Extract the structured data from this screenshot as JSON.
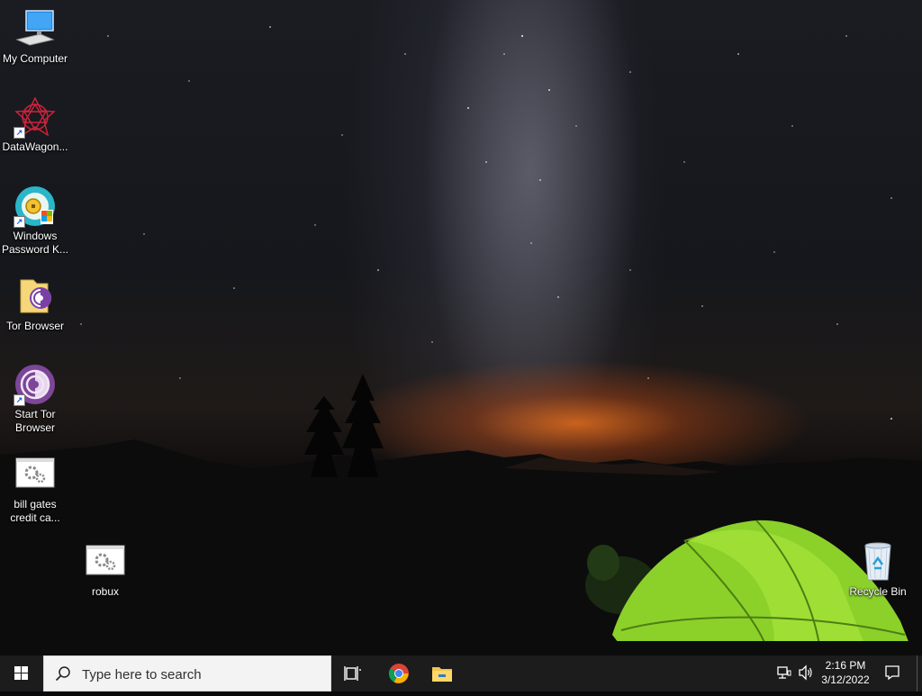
{
  "desktop": {
    "icons": [
      {
        "label": "My Computer",
        "icon": "computer-icon"
      },
      {
        "label": "DataWagon...",
        "icon": "datawagon-icon"
      },
      {
        "label": "Windows Password K...",
        "icon": "password-key-icon"
      },
      {
        "label": "Tor Browser",
        "icon": "tor-folder-icon"
      },
      {
        "label": "Start Tor Browser",
        "icon": "tor-onion-icon"
      },
      {
        "label": "bill gates credit ca...",
        "icon": "executable-icon"
      },
      {
        "label": "robux",
        "icon": "executable-icon"
      },
      {
        "label": "Recycle Bin",
        "icon": "recycle-bin-icon"
      }
    ]
  },
  "taskbar": {
    "search_placeholder": "Type here to search",
    "clock_time": "2:16 PM",
    "clock_date": "3/12/2022",
    "pinned": [
      "task-view-icon",
      "chrome-icon",
      "file-explorer-icon"
    ],
    "tray": [
      "network-icon",
      "volume-icon",
      "notification-icon"
    ]
  },
  "colors": {
    "taskbar_bg": "#1c1c1c",
    "search_bg": "#f3f3f3",
    "tent_green": "#8bd12a",
    "glow_orange": "#e06a1e"
  }
}
